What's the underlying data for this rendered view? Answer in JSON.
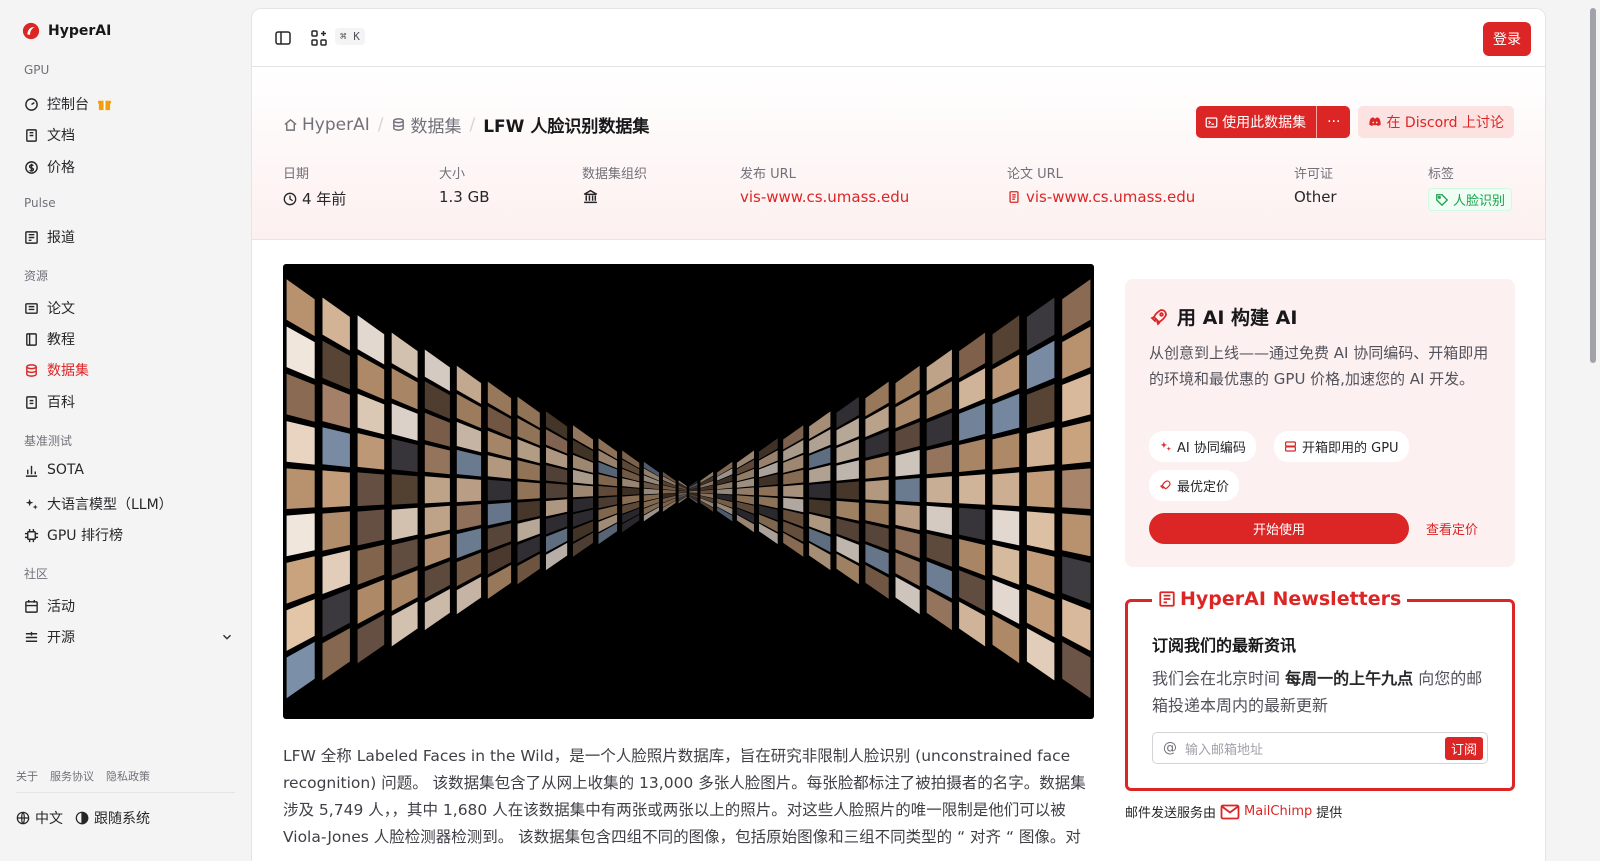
{
  "brand": {
    "name": "HyperAI"
  },
  "sidebar": {
    "sections": [
      {
        "title": "GPU",
        "items": [
          {
            "label": "控制台"
          },
          {
            "label": "文档"
          },
          {
            "label": "价格"
          }
        ]
      },
      {
        "title": "Pulse",
        "items": [
          {
            "label": "报道"
          }
        ]
      },
      {
        "title": "资源",
        "items": [
          {
            "label": "论文"
          },
          {
            "label": "教程"
          },
          {
            "label": "数据集"
          },
          {
            "label": "百科"
          }
        ]
      },
      {
        "title": "基准测试",
        "items": [
          {
            "label": "SOTA"
          },
          {
            "label": "大语言模型（LLM）"
          },
          {
            "label": "GPU 排行榜"
          }
        ]
      },
      {
        "title": "社区",
        "items": [
          {
            "label": "活动"
          },
          {
            "label": "开源"
          }
        ]
      }
    ],
    "footer_links": [
      "关于",
      "服务协议",
      "隐私政策"
    ],
    "language": "中文",
    "theme": "跟随系统"
  },
  "topbar": {
    "shortcut": "⌘ K",
    "login": "登录"
  },
  "header": {
    "breadcrumbs": [
      "HyperAI",
      "数据集",
      "LFW 人脸识别数据集"
    ],
    "use_dataset": "使用此数据集",
    "more": "···",
    "discord": "在 Discord 上讨论",
    "meta": [
      {
        "label": "日期",
        "value": "4 年前"
      },
      {
        "label": "大小",
        "value": "1.3 GB"
      },
      {
        "label": "数据集组织",
        "value": ""
      },
      {
        "label": "发布 URL",
        "value": "vis-www.cs.umass.edu"
      },
      {
        "label": "论文 URL",
        "value": "vis-www.cs.umass.edu"
      },
      {
        "label": "许可证",
        "value": "Other"
      },
      {
        "label": "标签",
        "value": "人脸识别"
      }
    ]
  },
  "description": "LFW 全称 Labeled Faces in the Wild，是一个人脸照片数据库，旨在研究非限制人脸识别 (unconstrained face recognition) 问题。 该数据集包含了从网上收集的 13,000 多张人脸图片。每张脸都标注了被拍摄者的名字。数据集涉及 5,749 人，，其中 1,680 人在该数据集中有两张或两张以上的照片。对这些人脸照片的唯一限制是他们可以被 Viola-Jones 人脸检测器检测到。 该数据集包含四组不同的图像，包括原始图像和三组不同类型的 “ 对齐 “ 图像。对",
  "promo": {
    "title": "用 AI 构建 AI",
    "text": "从创意到上线——通过免费 AI 协同编码、开箱即用的环境和最优惠的 GPU 价格,加速您的 AI 开发。",
    "chips": [
      "AI 协同编码",
      "开箱即用的 GPU",
      "最优定价"
    ],
    "start": "开始使用",
    "pricing": "查看定价"
  },
  "newsletter": {
    "title": "HyperAI Newsletters",
    "heading": "订阅我们的最新资讯",
    "text_pre": "我们会在北京时间 ",
    "text_bold": "每周一的上午九点",
    "text_post": " 向您的邮箱投递本周内的最新更新",
    "placeholder": "输入邮箱地址",
    "subscribe": "订阅",
    "by_pre": "邮件发送服务由",
    "by_name": "MailChimp",
    "by_post": "提供"
  }
}
